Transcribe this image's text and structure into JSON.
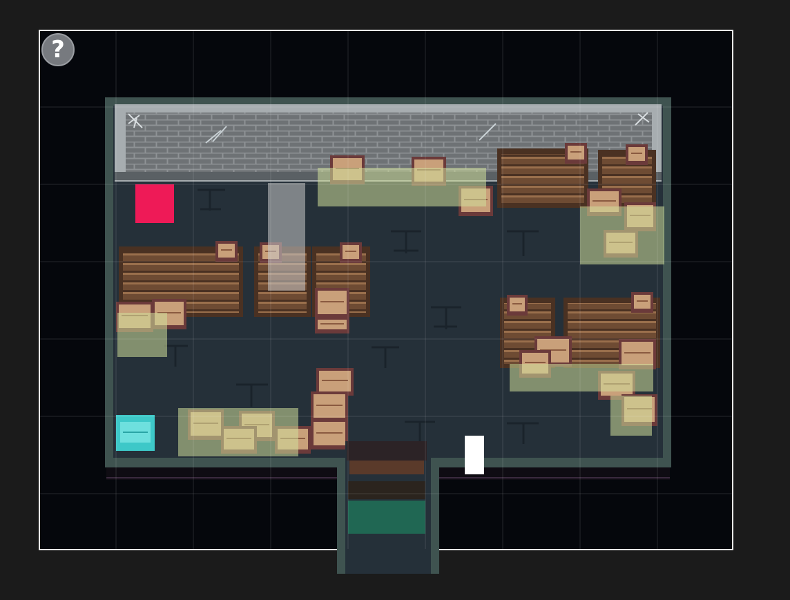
{
  "help": {
    "label": "?"
  },
  "colors": {
    "frame": "#e8e8e8",
    "void": "#05070c",
    "floor": "#253039",
    "wall_trim": "#3f5350",
    "brick_face": "#6e7275",
    "brick_line": "#8e9295",
    "shelf_wood": "#7a5438",
    "crate": "#c9a07a",
    "highlight_zone": "#cfdf9a",
    "goal_marker": "#ee1a57",
    "player_marker": "#ffffff",
    "selected_crate": "#3ec8c8",
    "exit_path": "#1f7a5c"
  },
  "markers": {
    "goal": {
      "icon": "red-square-goal"
    },
    "player": {
      "icon": "white-player-block"
    },
    "selected": {
      "icon": "cyan-highlighted-crate"
    }
  }
}
